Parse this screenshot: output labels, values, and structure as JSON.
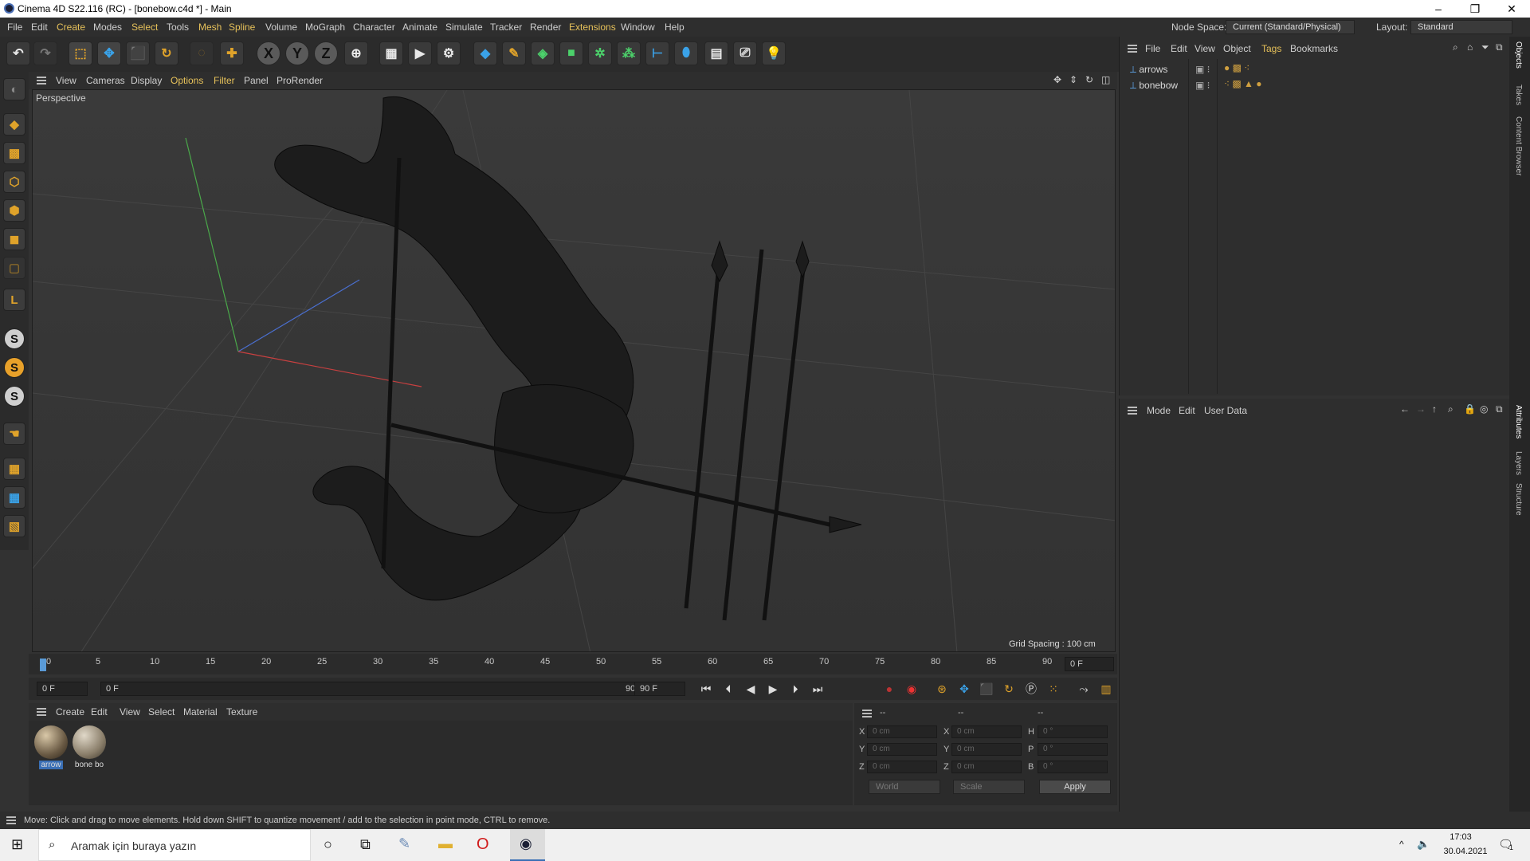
{
  "window": {
    "title": "Cinema 4D S22.116 (RC) - [bonebow.c4d *] - Main",
    "minimize": "–",
    "maximize": "❐",
    "close": "✕"
  },
  "menu": [
    "File",
    "Edit",
    "Create",
    "Modes",
    "Select",
    "Tools",
    "Mesh",
    "Spline",
    "Volume",
    "MoGraph",
    "Character",
    "Animate",
    "Simulate",
    "Tracker",
    "Render",
    "Extensions",
    "Window",
    "Help"
  ],
  "node_space": {
    "label": "Node Space:",
    "value": "Current (Standard/Physical)"
  },
  "layout": {
    "label": "Layout:",
    "value": "Standard"
  },
  "toolbar": {
    "x": "X",
    "y": "Y",
    "z": "Z"
  },
  "viewport": {
    "menu": [
      "View",
      "Cameras",
      "Display",
      "Options",
      "Filter",
      "Panel",
      "ProRender"
    ],
    "label": "Perspective",
    "grid_spacing": "Grid Spacing : 100 cm"
  },
  "timeline": {
    "ticks": [
      "0",
      "5",
      "10",
      "15",
      "20",
      "25",
      "30",
      "35",
      "40",
      "45",
      "50",
      "55",
      "60",
      "65",
      "70",
      "75",
      "80",
      "85",
      "90"
    ],
    "current_frame": "0 F"
  },
  "transport": {
    "start": "0 F",
    "range_start": "0 F",
    "range_end": "90 F",
    "end": "90 F"
  },
  "materials": {
    "menu": [
      "Create",
      "Edit",
      "View",
      "Select",
      "Material",
      "Texture"
    ],
    "items": [
      {
        "name": "arrow"
      },
      {
        "name": "bone bo"
      }
    ]
  },
  "coords": {
    "headers": [
      "--",
      "--",
      "--"
    ],
    "rows": [
      {
        "a": "X",
        "av": "0 cm",
        "b": "X",
        "bv": "0 cm",
        "c": "H",
        "cv": "0 °"
      },
      {
        "a": "Y",
        "av": "0 cm",
        "b": "Y",
        "bv": "0 cm",
        "c": "P",
        "cv": "0 °"
      },
      {
        "a": "Z",
        "av": "0 cm",
        "b": "Z",
        "bv": "0 cm",
        "c": "B",
        "cv": "0 °"
      }
    ],
    "world": "World",
    "scale": "Scale",
    "apply": "Apply"
  },
  "objects": {
    "menu": [
      "File",
      "Edit",
      "View",
      "Object",
      "Tags",
      "Bookmarks"
    ],
    "items": [
      {
        "name": "arrows"
      },
      {
        "name": "bonebow"
      }
    ]
  },
  "attributes": {
    "menu": [
      "Mode",
      "Edit",
      "User Data"
    ]
  },
  "side_tabs": [
    "Objects",
    "Takes",
    "Content Browser",
    "Attributes",
    "Layers",
    "Structure"
  ],
  "status": "Move: Click and drag to move elements. Hold down SHIFT to quantize movement / add to the selection in point mode, CTRL to remove.",
  "taskbar": {
    "search_placeholder": "Aramak için buraya yazın",
    "time": "17:03",
    "date": "30.04.2021",
    "notif_count": "1"
  }
}
